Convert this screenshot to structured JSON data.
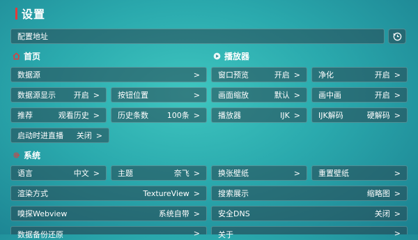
{
  "page_title": "设置",
  "config_address": "配置地址",
  "sections": {
    "home": "首页",
    "player": "播放器",
    "system": "系统"
  },
  "home": {
    "datasource": {
      "label": "数据源",
      "value": ""
    },
    "datasource_display": {
      "label": "数据源显示",
      "value": "开启"
    },
    "button_position": {
      "label": "按钮位置",
      "value": ""
    },
    "recommend": {
      "label": "推荐",
      "value": "观看历史"
    },
    "history_count": {
      "label": "历史条数",
      "value": "100条"
    },
    "startup_live": {
      "label": "启动时进直播",
      "value": "关闭"
    }
  },
  "player": {
    "window_preview": {
      "label": "窗口预览",
      "value": "开启"
    },
    "purify": {
      "label": "净化",
      "value": "开启"
    },
    "scale": {
      "label": "画面缩放",
      "value": "默认"
    },
    "pip": {
      "label": "画中画",
      "value": "开启"
    },
    "player": {
      "label": "播放器",
      "value": "IJK"
    },
    "ijk_decode": {
      "label": "IJK解码",
      "value": "硬解码"
    }
  },
  "system": {
    "language": {
      "label": "语言",
      "value": "中文"
    },
    "theme": {
      "label": "主题",
      "value": "奈飞"
    },
    "change_wallpaper": {
      "label": "换张壁纸",
      "value": ""
    },
    "reset_wallpaper": {
      "label": "重置壁纸",
      "value": ""
    },
    "render_mode": {
      "label": "渲染方式",
      "value": "TextureView"
    },
    "search_display": {
      "label": "搜索展示",
      "value": "缩略图"
    },
    "sniff_webview": {
      "label": "嗅探Webview",
      "value": "系统自带"
    },
    "secure_dns": {
      "label": "安全DNS",
      "value": "关闭"
    },
    "backup_restore": {
      "label": "数据备份还原",
      "value": ""
    },
    "about": {
      "label": "关于",
      "value": ""
    }
  },
  "chevron": ">",
  "colors": {
    "accent": "#e23b3b"
  }
}
